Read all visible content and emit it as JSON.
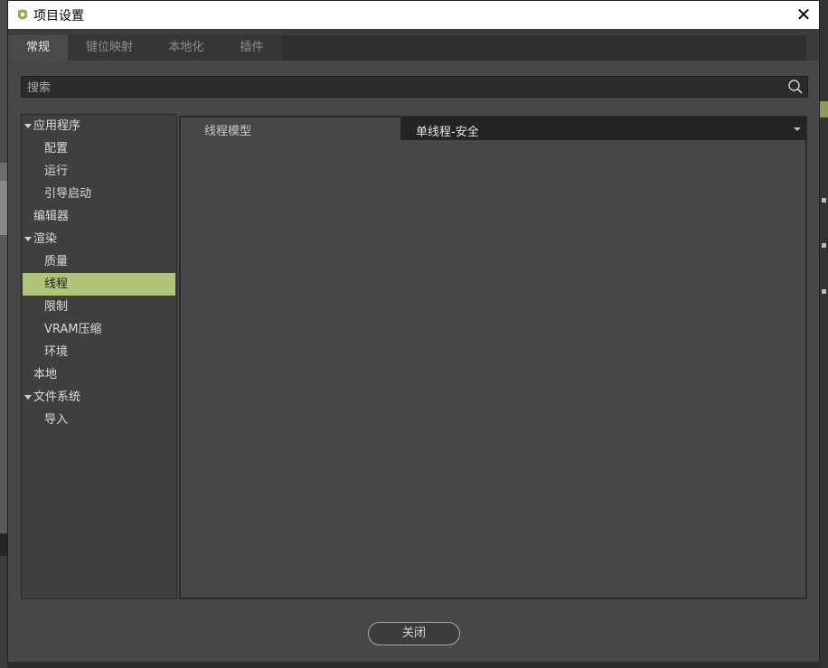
{
  "window": {
    "title": "项目设置",
    "close_glyph": "✕"
  },
  "tabs": [
    {
      "label": "常规",
      "active": true
    },
    {
      "label": "键位映射",
      "active": false
    },
    {
      "label": "本地化",
      "active": false
    },
    {
      "label": "插件",
      "active": false
    }
  ],
  "search": {
    "placeholder": "搜索",
    "icon": "search-icon"
  },
  "tree": {
    "items": [
      {
        "label": "应用程序",
        "expandable": true,
        "level": 0
      },
      {
        "label": "配置",
        "level": 1
      },
      {
        "label": "运行",
        "level": 1
      },
      {
        "label": "引导启动",
        "level": 1
      },
      {
        "label": "编辑器",
        "level": 0
      },
      {
        "label": "渲染",
        "expandable": true,
        "level": 0
      },
      {
        "label": "质量",
        "level": 1
      },
      {
        "label": "线程",
        "level": 1,
        "selected": true
      },
      {
        "label": "限制",
        "level": 1
      },
      {
        "label": "VRAM压缩",
        "level": 1
      },
      {
        "label": "环境",
        "level": 1
      },
      {
        "label": "本地",
        "level": 0
      },
      {
        "label": "文件系统",
        "expandable": true,
        "level": 0
      },
      {
        "label": "导入",
        "level": 1
      }
    ]
  },
  "content": {
    "property_label": "线程模型",
    "property_value": "单线程-安全"
  },
  "footer": {
    "close_label": "关闭"
  },
  "colors": {
    "selection": "#afc47a",
    "panel": "#474747",
    "dropdown_bg": "#232323"
  }
}
